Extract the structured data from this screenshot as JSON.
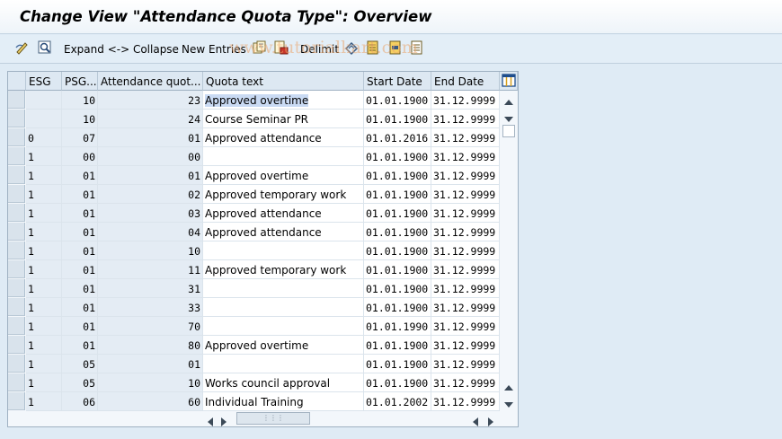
{
  "window": {
    "title": "Change View \"Attendance Quota Type\": Overview"
  },
  "toolbar": {
    "expand_collapse": "Expand <-> Collapse",
    "new_entries": "New Entries",
    "delimit": "Delimit",
    "watermark": "www.tutorialkart.com"
  },
  "table": {
    "columns": [
      "ESG",
      "PSG...",
      "Attendance quot...",
      "Quota text",
      "Start Date",
      "End Date"
    ],
    "rows": [
      {
        "esg": "",
        "psg": "10",
        "quota": "23",
        "text": "Approved overtime",
        "start": "01.01.1900",
        "end": "31.12.9999"
      },
      {
        "esg": "",
        "psg": "10",
        "quota": "24",
        "text": "Course Seminar PR",
        "start": "01.01.1900",
        "end": "31.12.9999"
      },
      {
        "esg": "0",
        "psg": "07",
        "quota": "01",
        "text": "Approved attendance",
        "start": "01.01.2016",
        "end": "31.12.9999"
      },
      {
        "esg": "1",
        "psg": "00",
        "quota": "00",
        "text": "",
        "start": "01.01.1900",
        "end": "31.12.9999"
      },
      {
        "esg": "1",
        "psg": "01",
        "quota": "01",
        "text": "Approved overtime",
        "start": "01.01.1900",
        "end": "31.12.9999"
      },
      {
        "esg": "1",
        "psg": "01",
        "quota": "02",
        "text": "Approved temporary work",
        "start": "01.01.1900",
        "end": "31.12.9999"
      },
      {
        "esg": "1",
        "psg": "01",
        "quota": "03",
        "text": "Approved attendance",
        "start": "01.01.1900",
        "end": "31.12.9999"
      },
      {
        "esg": "1",
        "psg": "01",
        "quota": "04",
        "text": "Approved attendance",
        "start": "01.01.1900",
        "end": "31.12.9999"
      },
      {
        "esg": "1",
        "psg": "01",
        "quota": "10",
        "text": "",
        "start": "01.01.1900",
        "end": "31.12.9999"
      },
      {
        "esg": "1",
        "psg": "01",
        "quota": "11",
        "text": "Approved temporary work",
        "start": "01.01.1900",
        "end": "31.12.9999"
      },
      {
        "esg": "1",
        "psg": "01",
        "quota": "31",
        "text": "",
        "start": "01.01.1900",
        "end": "31.12.9999"
      },
      {
        "esg": "1",
        "psg": "01",
        "quota": "33",
        "text": "",
        "start": "01.01.1900",
        "end": "31.12.9999"
      },
      {
        "esg": "1",
        "psg": "01",
        "quota": "70",
        "text": "",
        "start": "01.01.1990",
        "end": "31.12.9999"
      },
      {
        "esg": "1",
        "psg": "01",
        "quota": "80",
        "text": "Approved overtime",
        "start": "01.01.1900",
        "end": "31.12.9999"
      },
      {
        "esg": "1",
        "psg": "05",
        "quota": "01",
        "text": "",
        "start": "01.01.1900",
        "end": "31.12.9999"
      },
      {
        "esg": "1",
        "psg": "05",
        "quota": "10",
        "text": "Works council approval",
        "start": "01.01.1900",
        "end": "31.12.9999"
      },
      {
        "esg": "1",
        "psg": "06",
        "quota": "60",
        "text": "Individual Training",
        "start": "01.01.2002",
        "end": "31.12.9999"
      }
    ]
  }
}
